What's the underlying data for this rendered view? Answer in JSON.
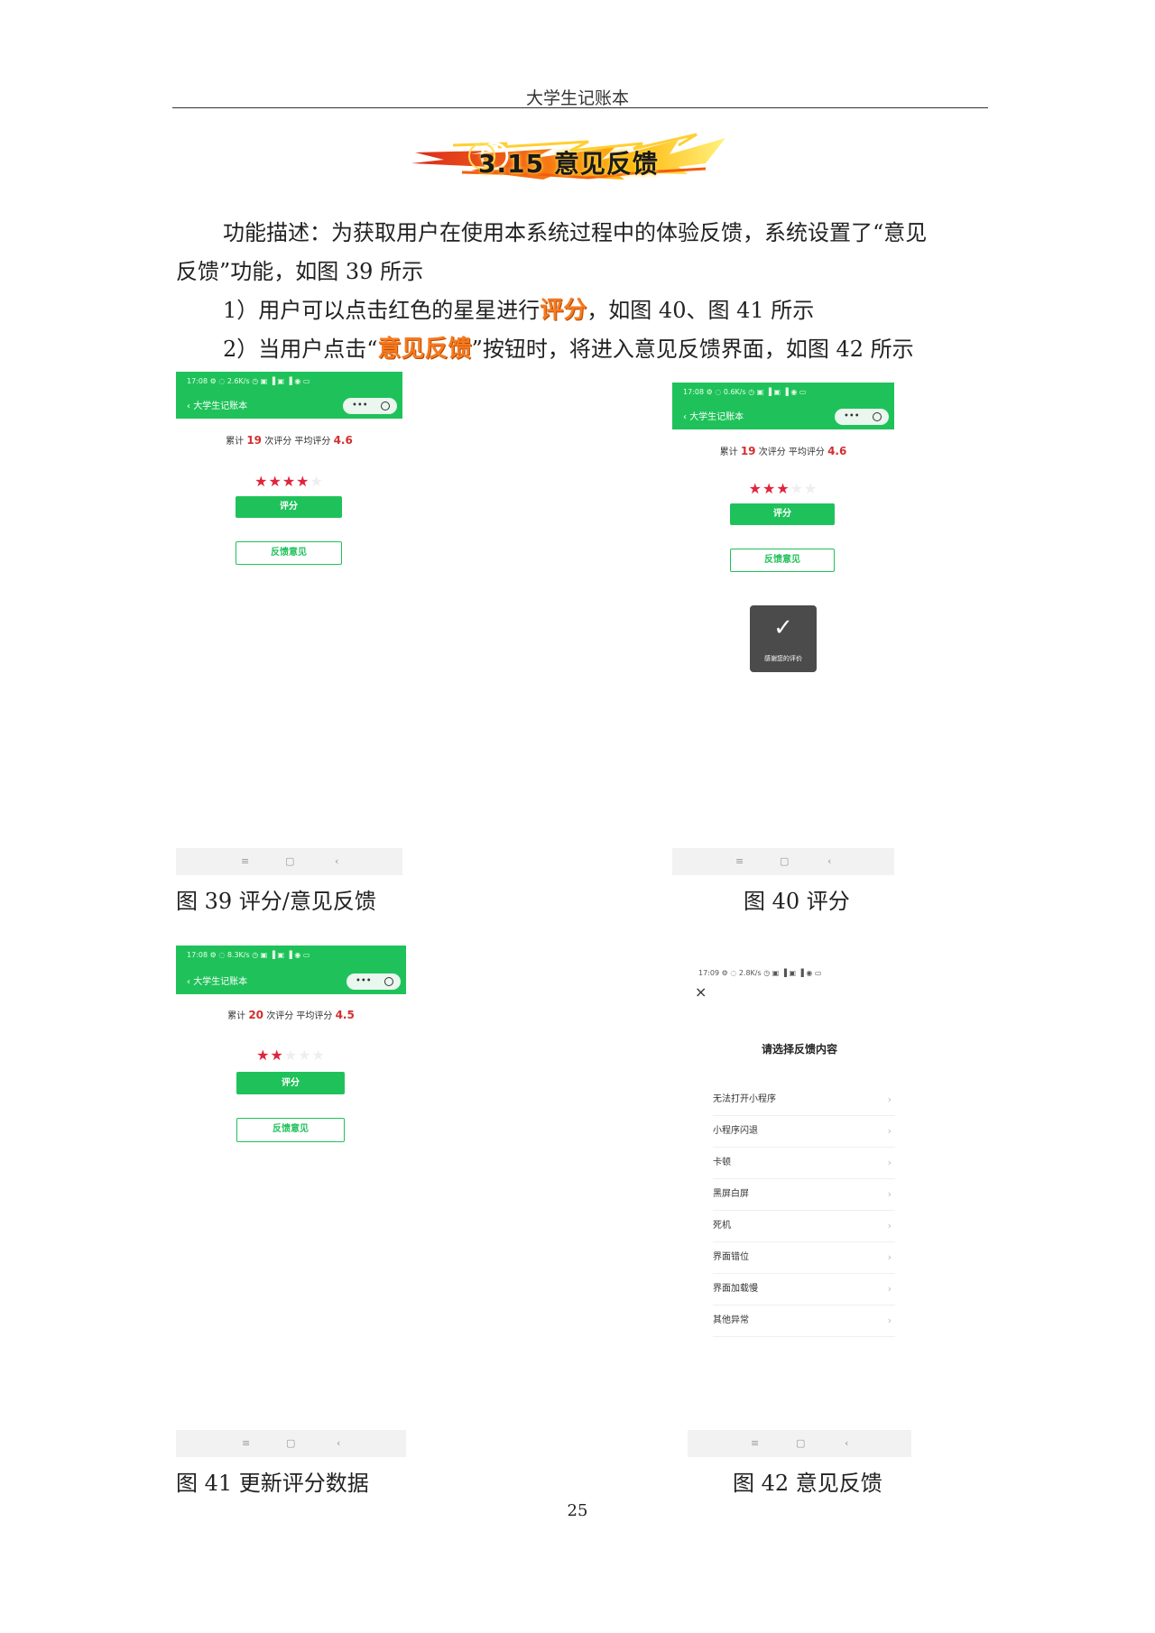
{
  "header": {
    "running_title": "大学生记账本"
  },
  "section": {
    "title": "3.15 意见反馈"
  },
  "body": {
    "p1": "功能描述：为获取用户在使用本系统过程中的体验反馈，系统设置了“意见",
    "p1_cont": "反馈”功能，如图 39 所示",
    "p2_prefix": "1）用户可以点击红色的星星进行",
    "p2_highlight": "评分",
    "p2_suffix": "，如图 40、图 41 所示",
    "p3_prefix": "2）当用户点击“",
    "p3_highlight": "意见反馈",
    "p3_suffix": "”按钮时，将进入意见反馈界面，如图 42 所示"
  },
  "screens": {
    "fig39": {
      "status": "17:08 ⚙ ◌    2.6K/s ◷ ▣ ▐ ▣ ▐ ◉ ▭",
      "nav_title": "大学生记账本",
      "stats_prefix": "累计 ",
      "count": "19",
      "stats_mid": " 次评分 平均评分 ",
      "avg": "4.6",
      "stars_on": "★★★★",
      "stars_off": "★",
      "rate_button": "评分",
      "feedback_button": "反馈意见",
      "nav_bar": [
        "≡",
        "▢",
        "‹"
      ]
    },
    "fig40": {
      "status": "17:08 ⚙ ◌    0.6K/s ◷ ▣ ▐ ▣ ▐ ◉ ▭",
      "nav_title": "大学生记账本",
      "stats_prefix": "累计 ",
      "count": "19",
      "stats_mid": " 次评分 平均评分 ",
      "avg": "4.6",
      "stars_on": "★★★",
      "stars_off": "★★",
      "rate_button": "评分",
      "feedback_button": "反馈意见",
      "toast_icon": "✓",
      "toast_text": "感谢您的评价",
      "nav_bar": [
        "≡",
        "▢",
        "‹"
      ]
    },
    "fig41": {
      "status": "17:08 ⚙ ◌    8.3K/s ◷ ▣ ▐ ▣ ▐ ◉ ▭",
      "nav_title": "大学生记账本",
      "stats_prefix": "累计 ",
      "count": "20",
      "stats_mid": " 次评分 平均评分 ",
      "avg": "4.5",
      "stars_on": "★★",
      "stars_off": "★★★",
      "rate_button": "评分",
      "feedback_button": "反馈意见",
      "nav_bar": [
        "≡",
        "▢",
        "‹"
      ]
    },
    "fig42": {
      "status": "17:09 ⚙ ◌    2.8K/s ◷ ▣ ▐ ▣ ▐ ◉ ▭",
      "close_icon": "×",
      "heading": "请选择反馈内容",
      "items": [
        "无法打开小程序",
        "小程序闪退",
        "卡顿",
        "黑屏白屏",
        "死机",
        "界面错位",
        "界面加载慢",
        "其他异常"
      ],
      "chevron": "›",
      "nav_bar": [
        "≡",
        "▢",
        "‹"
      ]
    }
  },
  "captions": {
    "fig39": "图 39  评分/意见反馈",
    "fig40": "图 40  评分",
    "fig41": "图 41  更新评分数据",
    "fig42": "图 42  意见反馈"
  },
  "page_number": "25",
  "colors": {
    "wechat_green": "#1fc25a",
    "star_red": "#e0243c",
    "highlight_orange": "#f47a20"
  }
}
